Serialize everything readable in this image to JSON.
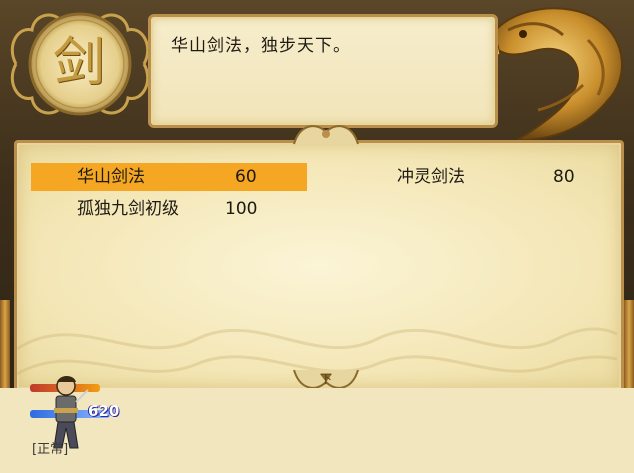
{
  "header": {
    "emblem_char": "剑",
    "description": "华山剑法，独步天下。"
  },
  "skills": [
    {
      "name": "华山剑法",
      "level": "60",
      "selected": true
    },
    {
      "name": "冲灵剑法",
      "level": "80",
      "selected": false
    },
    {
      "name": "孤独九剑初级",
      "level": "100",
      "selected": false
    }
  ],
  "scroll": {
    "down_label": "下"
  },
  "player": {
    "hp_value": "620",
    "status": "[正常]"
  },
  "colors": {
    "highlight": "#f5a623",
    "parchment": "#f3e5b3",
    "frame": "#b98f4b"
  }
}
